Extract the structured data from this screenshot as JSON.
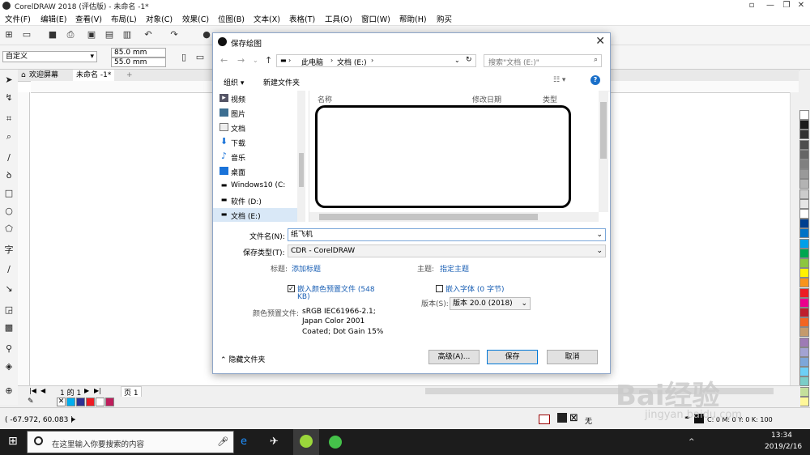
{
  "window": {
    "title": "CorelDRAW 2018 (评估版) - 未命名 -1*"
  },
  "menubar": [
    "文件(F)",
    "编辑(E)",
    "查看(V)",
    "布局(L)",
    "对象(C)",
    "效果(C)",
    "位图(B)",
    "文本(X)",
    "表格(T)",
    "工具(O)",
    "窗口(W)",
    "帮助(H)",
    "购买"
  ],
  "propbar": {
    "preset": "自定义",
    "width": "85.0 mm",
    "height": "55.0 mm"
  },
  "doctabs": {
    "welcome": "欢迎屏幕",
    "doc": "未命名 -1*"
  },
  "pagebar": {
    "pages": "1 的 1",
    "page_tab": "页 1"
  },
  "status": {
    "coords": "( -67.972, 60.083 )",
    "fill_none": "无",
    "color_info": "C: 0 M: 0 Y: 0 K: 100"
  },
  "taskbar": {
    "search_placeholder": "在这里输入你要搜索的内容",
    "time": "13:34",
    "date": "2019/2/16"
  },
  "dialog": {
    "title": "保存绘图",
    "breadcrumb": [
      "此电脑",
      "文档 (E:)"
    ],
    "search_placeholder": "搜索\"文档 (E:)\"",
    "cmd": {
      "organize": "组织",
      "new_folder": "新建文件夹"
    },
    "nav_items": [
      {
        "label": "视频",
        "icon": "video-icon"
      },
      {
        "label": "图片",
        "icon": "picture-icon"
      },
      {
        "label": "文档",
        "icon": "document-icon"
      },
      {
        "label": "下载",
        "icon": "download-icon"
      },
      {
        "label": "音乐",
        "icon": "music-icon"
      },
      {
        "label": "桌面",
        "icon": "desktop-icon"
      },
      {
        "label": "Windows10 (C:",
        "icon": "drive-icon"
      },
      {
        "label": "软件 (D:)",
        "icon": "drive-icon"
      },
      {
        "label": "文档 (E:)",
        "icon": "drive-icon"
      }
    ],
    "columns": {
      "name": "名称",
      "modified": "修改日期",
      "type": "类型"
    },
    "filename_label": "文件名(N):",
    "filename_value": "纸飞机",
    "filetype_label": "保存类型(T):",
    "filetype_value": "CDR - CorelDRAW",
    "tags_label": "标题:",
    "tags_link": "添加标题",
    "subject_label": "主题:",
    "subject_link": "指定主题",
    "embed_profile_line1": "嵌入颜色预置文件 (548",
    "embed_profile_line2": "KB)",
    "embed_fonts": "嵌入字体 (0 字节)",
    "version_label": "版本(S):",
    "version_value": "版本 20.0 (2018)",
    "profile_label": "颜色预置文件:",
    "profile_lines": [
      "sRGB IEC61966-2.1;",
      "Japan Color 2001",
      "Coated; Dot Gain 15%"
    ],
    "hide_folders": "隐藏文件夹",
    "buttons": {
      "advanced": "高级(A)...",
      "save": "保存",
      "cancel": "取消"
    }
  },
  "watermark": {
    "brand": "Bai经验",
    "url": "jingyan.baidu.com"
  },
  "palette": [
    "#ffffff",
    "#1a1a1a",
    "#333333",
    "#4d4d4d",
    "#666666",
    "#808080",
    "#999999",
    "#b3b3b3",
    "#cccccc",
    "#e6e6e6",
    "#ffffff",
    "#003f8f",
    "#0072c6",
    "#00a0e9",
    "#00a650",
    "#8cc63f",
    "#fff200",
    "#f7941d",
    "#ed1c24",
    "#ec008c",
    "#be1e2d",
    "#f26522",
    "#c49a6c",
    "#9e7bb5",
    "#a3a3d2",
    "#7da7d9",
    "#6dcff6",
    "#7bcdc8",
    "#c4df9b",
    "#fff799"
  ],
  "doc_palette": [
    "#00aeef",
    "#2e3192",
    "#ed1c24",
    "#ffffff",
    "#be1e5c"
  ]
}
